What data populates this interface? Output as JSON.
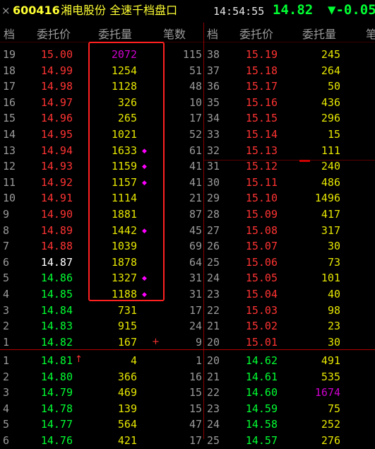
{
  "title_bar": {
    "close_glyph": "×",
    "stock_code": "600416",
    "window_name": "湘电股份 全速千档盘口",
    "time": "14:54:55",
    "last_price": "14.82",
    "change": "▼-0.05"
  },
  "headers": {
    "left": [
      "档",
      "委托价",
      "委托量",
      "笔数"
    ],
    "right": [
      "档",
      "委托价",
      "委托量",
      "笔"
    ]
  },
  "sell_left": [
    {
      "lvl": "19",
      "price": "15.00",
      "vol": "2072",
      "cnt": "115",
      "pc": "red",
      "vc": "purple",
      "mark": false
    },
    {
      "lvl": "18",
      "price": "14.99",
      "vol": "1254",
      "cnt": "51",
      "pc": "red",
      "vc": "yellow",
      "mark": false
    },
    {
      "lvl": "17",
      "price": "14.98",
      "vol": "1128",
      "cnt": "48",
      "pc": "red",
      "vc": "yellow",
      "mark": false
    },
    {
      "lvl": "16",
      "price": "14.97",
      "vol": "326",
      "cnt": "10",
      "pc": "red",
      "vc": "yellow",
      "mark": false
    },
    {
      "lvl": "15",
      "price": "14.96",
      "vol": "265",
      "cnt": "17",
      "pc": "red",
      "vc": "yellow",
      "mark": false
    },
    {
      "lvl": "14",
      "price": "14.95",
      "vol": "1021",
      "cnt": "52",
      "pc": "red",
      "vc": "yellow",
      "mark": false
    },
    {
      "lvl": "13",
      "price": "14.94",
      "vol": "1633",
      "cnt": "61",
      "pc": "red",
      "vc": "yellow",
      "mark": true
    },
    {
      "lvl": "12",
      "price": "14.93",
      "vol": "1159",
      "cnt": "41",
      "pc": "red",
      "vc": "yellow",
      "mark": true
    },
    {
      "lvl": "11",
      "price": "14.92",
      "vol": "1157",
      "cnt": "41",
      "pc": "red",
      "vc": "yellow",
      "mark": true
    },
    {
      "lvl": "10",
      "price": "14.91",
      "vol": "1114",
      "cnt": "21",
      "pc": "red",
      "vc": "yellow",
      "mark": false
    },
    {
      "lvl": "9",
      "price": "14.90",
      "vol": "1881",
      "cnt": "87",
      "pc": "red",
      "vc": "yellow",
      "mark": false
    },
    {
      "lvl": "8",
      "price": "14.89",
      "vol": "1442",
      "cnt": "45",
      "pc": "red",
      "vc": "yellow",
      "mark": true
    },
    {
      "lvl": "7",
      "price": "14.88",
      "vol": "1039",
      "cnt": "69",
      "pc": "red",
      "vc": "yellow",
      "mark": false
    },
    {
      "lvl": "6",
      "price": "14.87",
      "vol": "1878",
      "cnt": "64",
      "pc": "white",
      "vc": "yellow",
      "mark": false
    },
    {
      "lvl": "5",
      "price": "14.86",
      "vol": "1327",
      "cnt": "31",
      "pc": "green",
      "vc": "yellow",
      "mark": true
    },
    {
      "lvl": "4",
      "price": "14.85",
      "vol": "1188",
      "cnt": "31",
      "pc": "green",
      "vc": "yellow",
      "mark": true
    },
    {
      "lvl": "3",
      "price": "14.84",
      "vol": "731",
      "cnt": "17",
      "pc": "green",
      "vc": "yellow",
      "mark": false
    },
    {
      "lvl": "2",
      "price": "14.83",
      "vol": "915",
      "cnt": "24",
      "pc": "green",
      "vc": "yellow",
      "mark": false
    },
    {
      "lvl": "1",
      "price": "14.82",
      "vol": "167",
      "cnt": "9",
      "pc": "green",
      "vc": "yellow",
      "mark": false,
      "plus": "+"
    }
  ],
  "sell_right": [
    {
      "lvl": "38",
      "price": "15.19",
      "vol": "245",
      "vc": "yellow"
    },
    {
      "lvl": "37",
      "price": "15.18",
      "vol": "264",
      "vc": "yellow"
    },
    {
      "lvl": "36",
      "price": "15.17",
      "vol": "50",
      "vc": "yellow"
    },
    {
      "lvl": "35",
      "price": "15.16",
      "vol": "436",
      "vc": "yellow"
    },
    {
      "lvl": "34",
      "price": "15.15",
      "vol": "296",
      "vc": "yellow"
    },
    {
      "lvl": "33",
      "price": "15.14",
      "vol": "15",
      "vc": "yellow"
    },
    {
      "lvl": "32",
      "price": "15.13",
      "vol": "111",
      "vc": "yellow"
    },
    {
      "lvl": "31",
      "price": "15.12",
      "vol": "240",
      "vc": "yellow"
    },
    {
      "lvl": "30",
      "price": "15.11",
      "vol": "486",
      "vc": "yellow"
    },
    {
      "lvl": "29",
      "price": "15.10",
      "vol": "1496",
      "vc": "yellow"
    },
    {
      "lvl": "28",
      "price": "15.09",
      "vol": "417",
      "vc": "yellow"
    },
    {
      "lvl": "27",
      "price": "15.08",
      "vol": "317",
      "vc": "yellow"
    },
    {
      "lvl": "26",
      "price": "15.07",
      "vol": "30",
      "vc": "yellow"
    },
    {
      "lvl": "25",
      "price": "15.06",
      "vol": "73",
      "vc": "yellow"
    },
    {
      "lvl": "24",
      "price": "15.05",
      "vol": "101",
      "vc": "yellow"
    },
    {
      "lvl": "23",
      "price": "15.04",
      "vol": "40",
      "vc": "yellow"
    },
    {
      "lvl": "22",
      "price": "15.03",
      "vol": "98",
      "vc": "yellow"
    },
    {
      "lvl": "21",
      "price": "15.02",
      "vol": "23",
      "vc": "yellow"
    },
    {
      "lvl": "20",
      "price": "15.01",
      "vol": "30",
      "vc": "yellow"
    }
  ],
  "buy_left": [
    {
      "lvl": "1",
      "price": "14.81",
      "vol": "4",
      "cnt": "1",
      "arrow": "↑"
    },
    {
      "lvl": "2",
      "price": "14.80",
      "vol": "366",
      "cnt": "16"
    },
    {
      "lvl": "3",
      "price": "14.79",
      "vol": "469",
      "cnt": "15"
    },
    {
      "lvl": "4",
      "price": "14.78",
      "vol": "139",
      "cnt": "15"
    },
    {
      "lvl": "5",
      "price": "14.77",
      "vol": "564",
      "cnt": "47"
    },
    {
      "lvl": "6",
      "price": "14.76",
      "vol": "421",
      "cnt": "17"
    }
  ],
  "buy_right": [
    {
      "lvl": "20",
      "price": "14.62",
      "vol": "491",
      "vc": "yellow"
    },
    {
      "lvl": "21",
      "price": "14.61",
      "vol": "535",
      "vc": "yellow"
    },
    {
      "lvl": "22",
      "price": "14.60",
      "vol": "1674",
      "vc": "purple"
    },
    {
      "lvl": "23",
      "price": "14.59",
      "vol": "75",
      "vc": "yellow"
    },
    {
      "lvl": "24",
      "price": "14.58",
      "vol": "252",
      "vc": "yellow"
    },
    {
      "lvl": "25",
      "price": "14.57",
      "vol": "276",
      "vc": "yellow"
    }
  ],
  "colors": {
    "red": "#ff3333",
    "green": "#00ff33",
    "yellow": "#e6e600",
    "purple": "#d000d0",
    "white": "#ffffff",
    "marker": "#ff00ff"
  }
}
